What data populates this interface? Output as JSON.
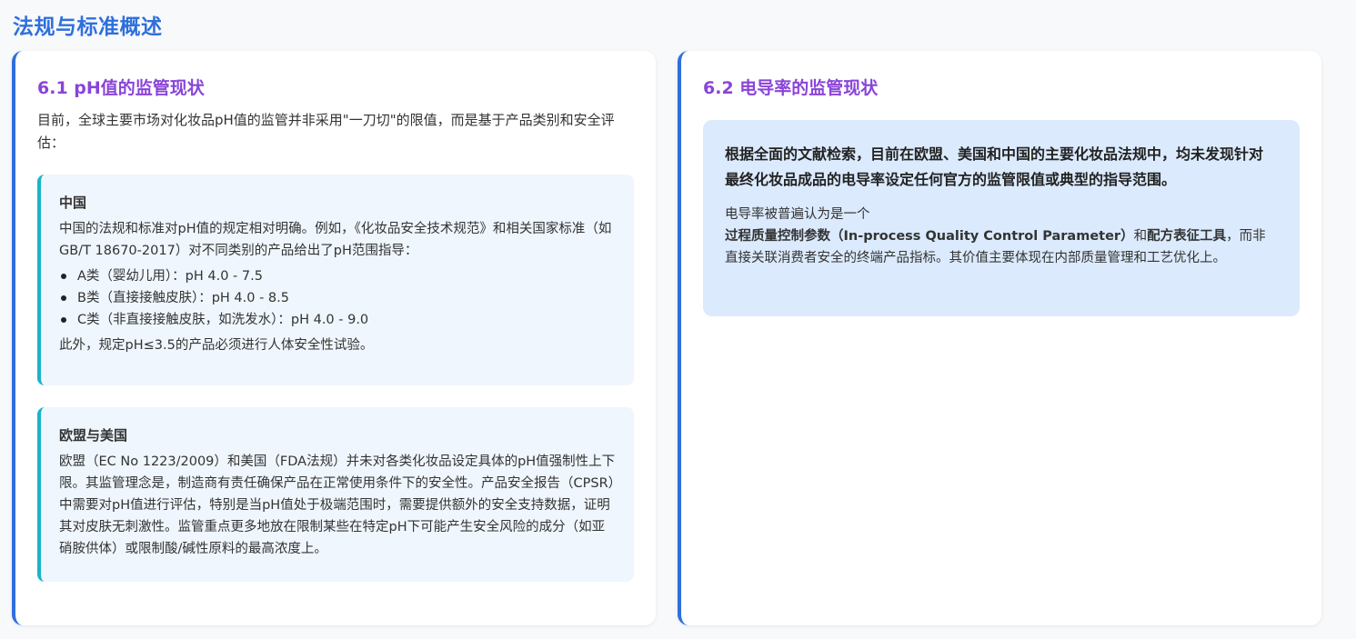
{
  "page": {
    "title": "法规与标准概述"
  },
  "left": {
    "title": "6.1 pH值的监管现状",
    "intro": "目前，全球主要市场对化妆品pH值的监管并非采用\"一刀切\"的限值，而是基于产品类别和安全评估：",
    "china": {
      "title": "中国",
      "body": "中国的法规和标准对pH值的规定相对明确。例如，《化妆品安全技术规范》和相关国家标准（如GB/T 18670-2017）对不同类别的产品给出了pH范围指导：",
      "items": [
        "A类（婴幼儿用）：pH 4.0 - 7.5",
        "B类（直接接触皮肤）：pH 4.0 - 8.5",
        "C类（非直接接触皮肤，如洗发水）：pH 4.0 - 9.0"
      ],
      "note": "此外，规定pH≤3.5的产品必须进行人体安全性试验。"
    },
    "eu": {
      "title": "欧盟与美国",
      "body": "欧盟（EC No 1223/2009）和美国（FDA法规）并未对各类化妆品设定具体的pH值强制性上下限。其监管理念是，制造商有责任确保产品在正常使用条件下的安全性。产品安全报告（CPSR）中需要对pH值进行评估，特别是当pH值处于极端范围时，需要提供额外的安全支持数据，证明其对皮肤无刺激性。监管重点更多地放在限制某些在特定pH下可能产生安全风险的成分（如亚硝胺供体）或限制酸/碱性原料的最高浓度上。"
    }
  },
  "right": {
    "title": "6.2 电导率的监管现状",
    "finding": {
      "main_prefix": "根据全面的文献检索，目前在欧盟、美国和中国的主要化妆品法规中，",
      "main_bold": "均未发现",
      "main_suffix": "针对最终化妆品成品的电导率设定任何官方的监管限值或典型的指导范围。",
      "sub_1": "电导率被普遍认为是一个",
      "sub_bold_1": "过程质量控制参数（In-process Quality Control Parameter）",
      "sub_2": "和",
      "sub_bold_2": "配方表征工具",
      "sub_3": "，而非直接关联消费者安全的终端产品指标。其价值主要体现在内部质量管理和工艺优化上。"
    }
  }
}
